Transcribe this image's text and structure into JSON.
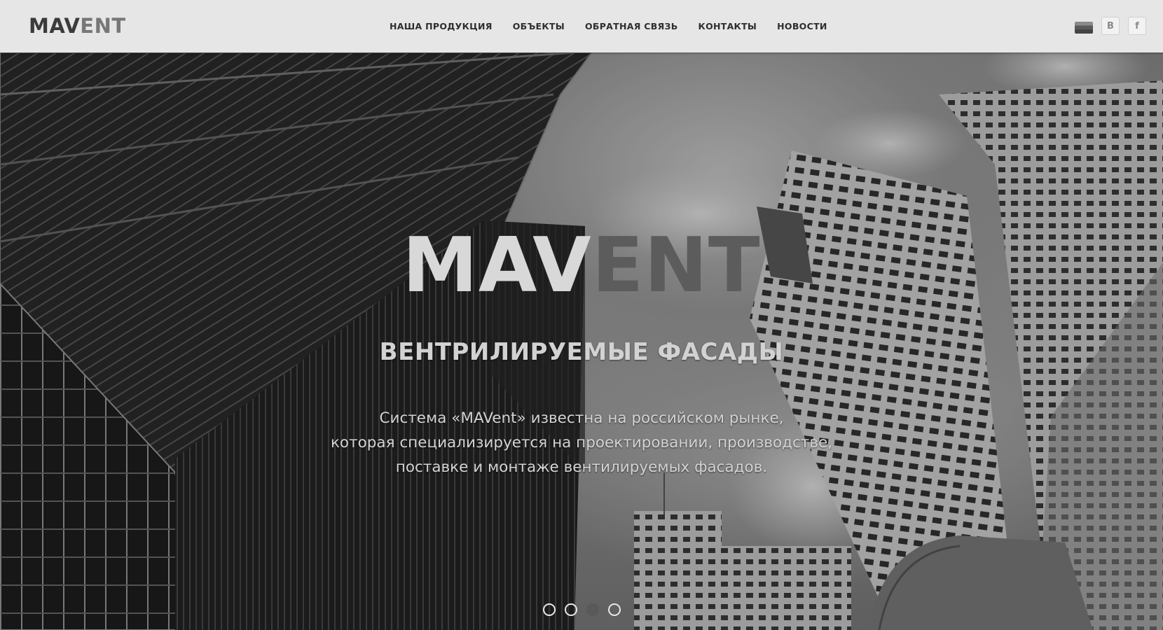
{
  "header": {
    "logo": {
      "part1": "MAV",
      "part2": "ENT"
    },
    "nav": [
      {
        "label": "НАША ПРОДУКЦИЯ"
      },
      {
        "label": "ОБЪЕКТЫ"
      },
      {
        "label": "ОБРАТНАЯ СВЯЗЬ"
      },
      {
        "label": "КОНТАКТЫ"
      },
      {
        "label": "НОВОСТИ"
      }
    ],
    "social": {
      "language_icon": "flag-icon",
      "vk": {
        "icon": "vk-icon",
        "label": "B"
      },
      "facebook": {
        "icon": "facebook-icon",
        "label": "f"
      }
    }
  },
  "hero": {
    "title": {
      "part1": "MAV",
      "part2": "ENT"
    },
    "subtitle": "ВЕНТРИЛИРУЕМЫЕ ФАСАДЫ",
    "description": [
      "Система «MAVent» известна на российском рынке,",
      "которая специализируется на проектировании, производстве,",
      "поставке и монтаже вентилируемых фасадов."
    ],
    "slider": {
      "count": 4,
      "active_index": 3
    }
  },
  "colors": {
    "header_bg": "#e6e6e6",
    "logo_dark": "#3b3b3b",
    "logo_light": "#777777",
    "text_light": "#d4d4d4"
  }
}
